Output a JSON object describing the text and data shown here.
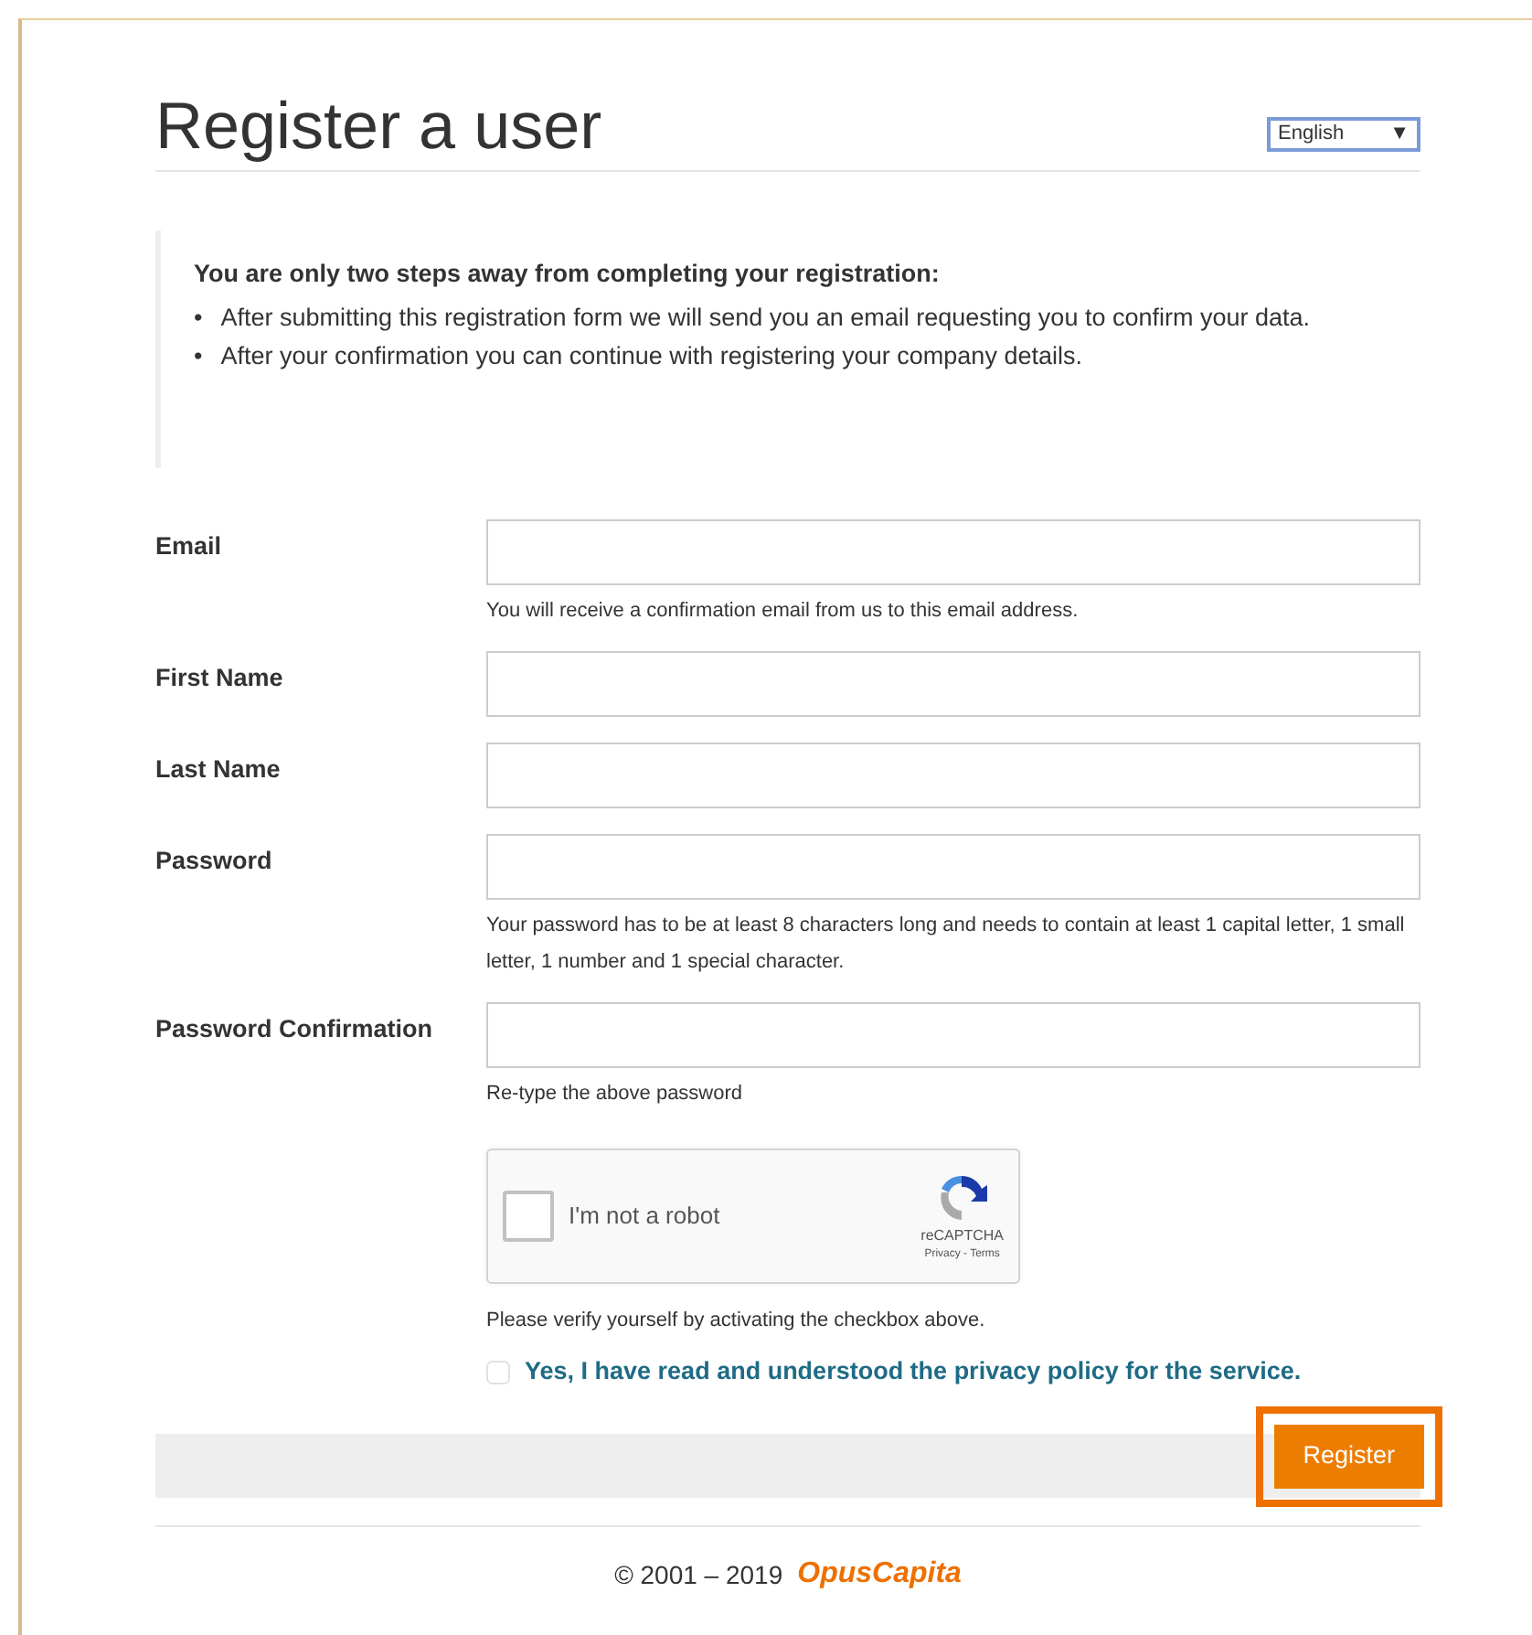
{
  "page": {
    "title": "Register a user",
    "language": "English",
    "caret": "▼"
  },
  "intro": {
    "heading": "You are only two steps away from completing your registration:",
    "bullet": "•",
    "items": [
      "After submitting this registration form we will send you an email requesting you to confirm your data.",
      "After your confirmation you can continue with registering your company details."
    ]
  },
  "fields": [
    {
      "label": "Email",
      "help": "You will receive a confirmation email from us to this email address."
    },
    {
      "label": "First Name"
    },
    {
      "label": "Last Name"
    },
    {
      "label": "Password",
      "help": "Your password has to be at least 8 characters long and needs to contain at least 1 capital letter, 1 small letter, 1 number and 1 special character."
    },
    {
      "label": "Password Confirmation",
      "help": "Re-type the above password"
    }
  ],
  "captcha": {
    "label": "I'm not a robot",
    "checked": false,
    "brand": "reCAPTCHA",
    "links": "Privacy - Terms",
    "help": "Please verify yourself by activating the checkbox above."
  },
  "privacy": {
    "label": "Yes, I have read and understood the privacy policy for the service.",
    "checked": false
  },
  "submit": {
    "label": "Register",
    "highlighted": true
  },
  "footer": {
    "copyright": "© 2001 – 2019",
    "brand": "OpusCapita"
  }
}
